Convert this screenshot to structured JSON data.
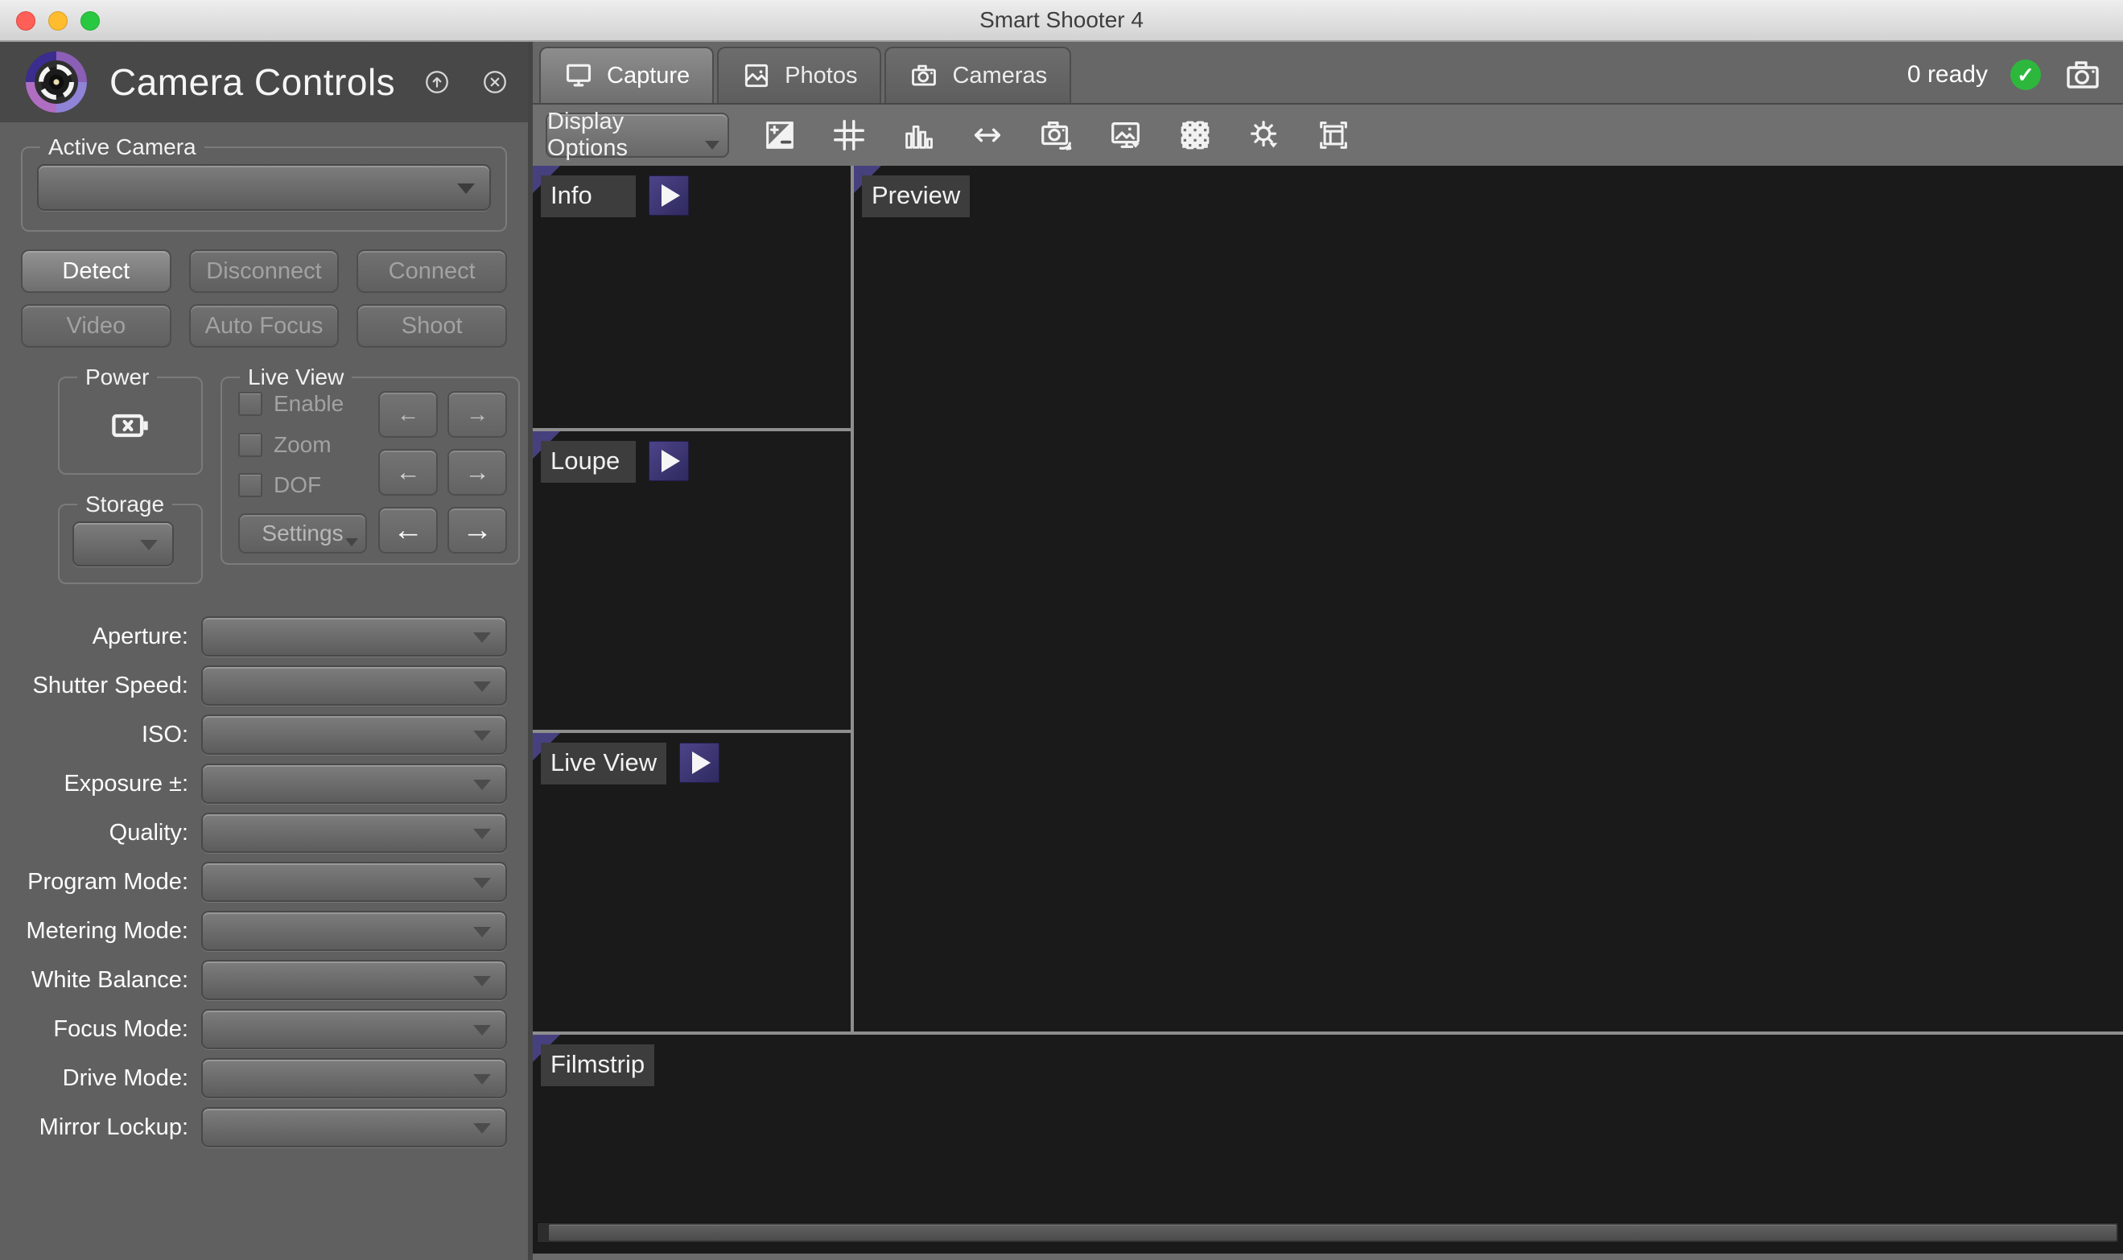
{
  "window": {
    "title": "Smart Shooter 4"
  },
  "sidebar": {
    "title": "Camera Controls",
    "header_icons": [
      "detach-panel-icon",
      "close-panel-icon"
    ],
    "active_camera": {
      "legend": "Active Camera",
      "value": ""
    },
    "action_buttons": [
      {
        "label": "Detect",
        "enabled": true
      },
      {
        "label": "Disconnect",
        "enabled": false
      },
      {
        "label": "Connect",
        "enabled": false
      },
      {
        "label": "Video",
        "enabled": false
      },
      {
        "label": "Auto Focus",
        "enabled": false
      },
      {
        "label": "Shoot",
        "enabled": false
      }
    ],
    "power": {
      "legend": "Power",
      "battery_icon": "battery-empty-icon"
    },
    "storage": {
      "legend": "Storage",
      "value": ""
    },
    "live_view": {
      "legend": "Live View",
      "checkboxes": [
        {
          "label": "Enable",
          "checked": false
        },
        {
          "label": "Zoom",
          "checked": false
        },
        {
          "label": "DOF",
          "checked": false
        }
      ],
      "settings_label": "Settings",
      "arrow_left": "←",
      "arrow_right": "→"
    },
    "params": [
      {
        "label": "Aperture:",
        "value": ""
      },
      {
        "label": "Shutter Speed:",
        "value": ""
      },
      {
        "label": "ISO:",
        "value": ""
      },
      {
        "label": "Exposure ±:",
        "value": ""
      },
      {
        "label": "Quality:",
        "value": ""
      },
      {
        "label": "Program Mode:",
        "value": ""
      },
      {
        "label": "Metering Mode:",
        "value": ""
      },
      {
        "label": "White Balance:",
        "value": ""
      },
      {
        "label": "Focus Mode:",
        "value": ""
      },
      {
        "label": "Drive Mode:",
        "value": ""
      },
      {
        "label": "Mirror Lockup:",
        "value": ""
      }
    ]
  },
  "main": {
    "tabs": [
      {
        "label": "Capture",
        "icon": "capture-display-icon",
        "active": true
      },
      {
        "label": "Photos",
        "icon": "photos-image-icon",
        "active": false
      },
      {
        "label": "Cameras",
        "icon": "cameras-camera-icon",
        "active": false
      }
    ],
    "toolbar": {
      "display_options_label": "Display Options",
      "icons": [
        "exposure-icon",
        "grid-icon",
        "histogram-icon",
        "fit-width-icon",
        "rotate-photo-icon",
        "show-image-icon",
        "checkerboard-icon",
        "brightness-icon",
        "layout-frame-icon"
      ]
    },
    "status": {
      "ready_text": "0 ready",
      "check_icon": "ready-check-icon",
      "camera_icon": "camera-status-icon"
    },
    "panels": {
      "info": "Info",
      "preview": "Preview",
      "loupe": "Loupe",
      "live_view": "Live View",
      "filmstrip": "Filmstrip"
    }
  },
  "colors": {
    "accent_purple": "#47407f",
    "status_green": "#2db83d"
  }
}
